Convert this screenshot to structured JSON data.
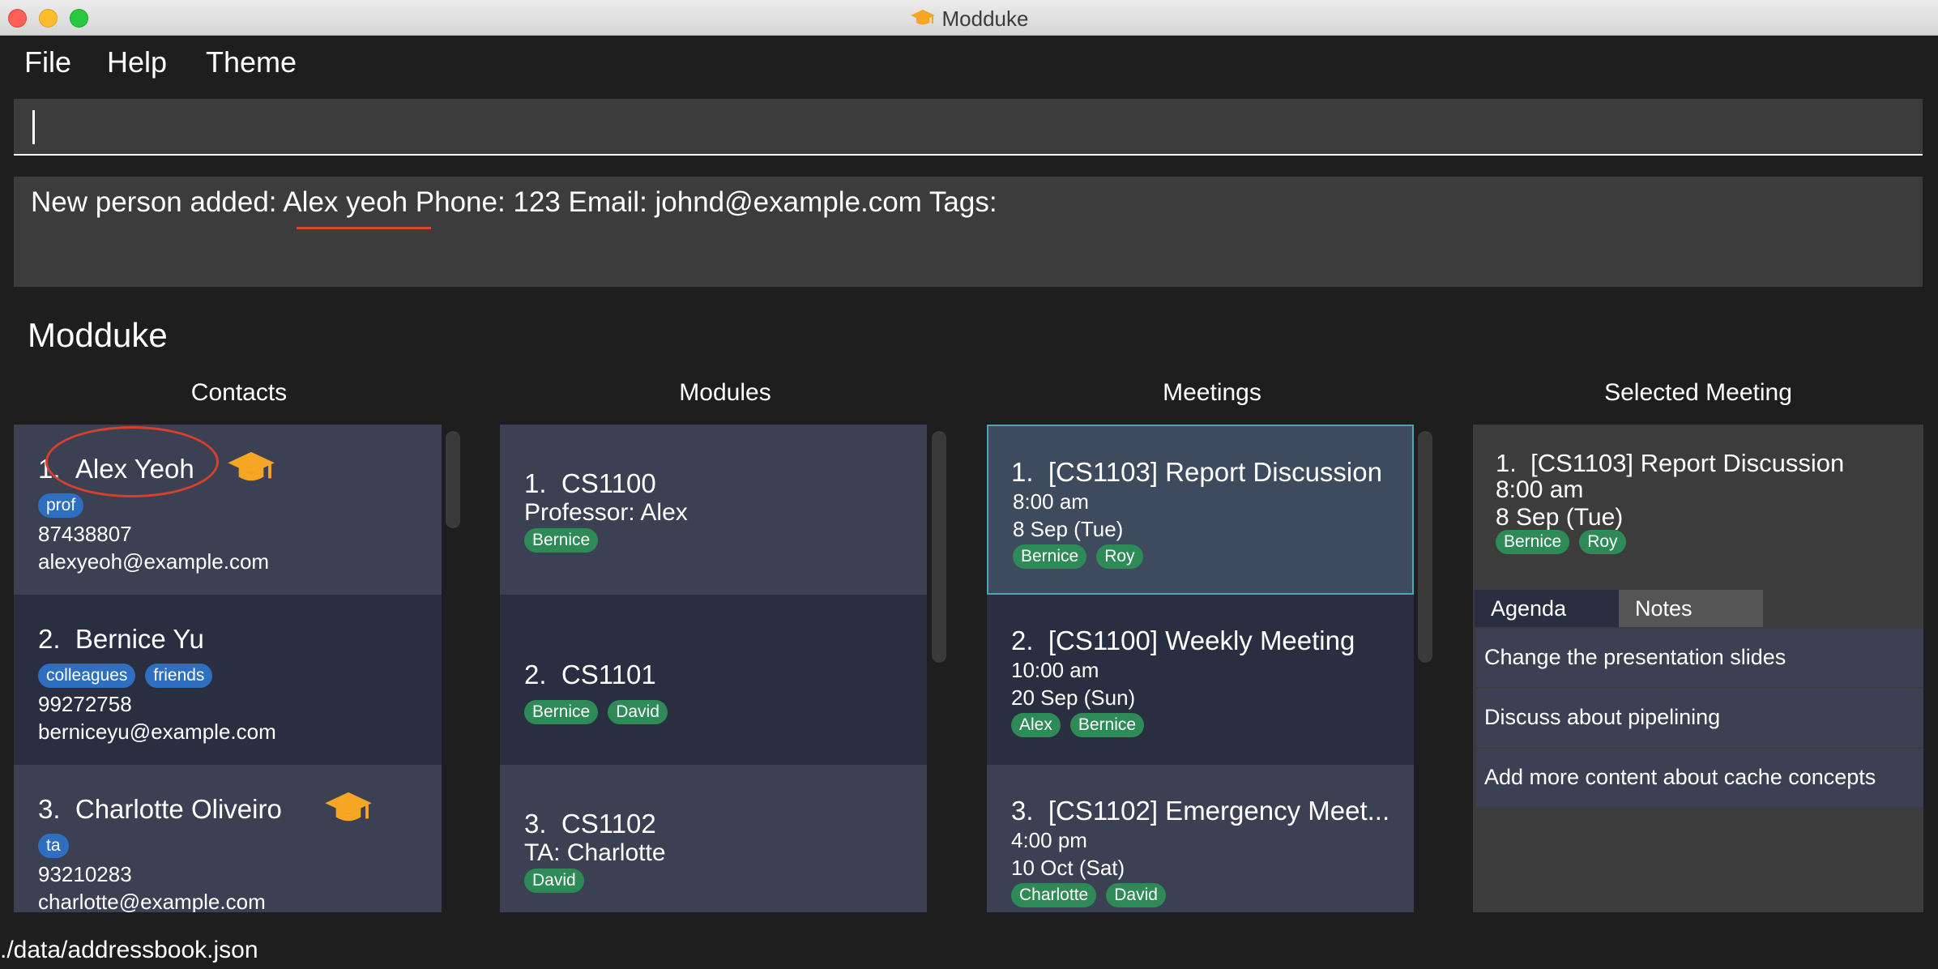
{
  "window": {
    "title": "Modduke"
  },
  "menu": {
    "file": "File",
    "help": "Help",
    "theme": "Theme"
  },
  "command": {
    "value": ""
  },
  "result": {
    "text_before": "New person added: ",
    "name": "Alex yeoh",
    "text_after": " Phone: 123 Email: johnd@example.com Tags:"
  },
  "app_title": "Modduke",
  "headers": {
    "contacts": "Contacts",
    "modules": "Modules",
    "meetings": "Meetings",
    "selected": "Selected Meeting"
  },
  "contacts": [
    {
      "index": "1.",
      "name": "Alex Yeoh",
      "tags": [
        "prof"
      ],
      "phone": "87438807",
      "email": "alexyeoh@example.com",
      "icon": "graduation-cap-icon"
    },
    {
      "index": "2.",
      "name": "Bernice Yu",
      "tags": [
        "colleagues",
        "friends"
      ],
      "phone": "99272758",
      "email": "berniceyu@example.com"
    },
    {
      "index": "3.",
      "name": "Charlotte Oliveiro",
      "tags": [
        "ta"
      ],
      "phone": "93210283",
      "email": "charlotte@example.com",
      "icon": "graduation-cap-icon"
    }
  ],
  "modules": [
    {
      "index": "1.",
      "code": "CS1100",
      "role": "Professor: Alex",
      "tags": [
        "Bernice"
      ]
    },
    {
      "index": "2.",
      "code": "CS1101",
      "role": "",
      "tags": [
        "Bernice",
        "David"
      ]
    },
    {
      "index": "3.",
      "code": "CS1102",
      "role": "TA: Charlotte",
      "tags": [
        "David"
      ]
    }
  ],
  "meetings": [
    {
      "index": "1.",
      "title": "[CS1103] Report Discussion",
      "time": "8:00 am",
      "date": "8 Sep (Tue)",
      "tags": [
        "Bernice",
        "Roy"
      ]
    },
    {
      "index": "2.",
      "title": "[CS1100] Weekly Meeting",
      "time": "10:00 am",
      "date": "20 Sep (Sun)",
      "tags": [
        "Alex",
        "Bernice"
      ]
    },
    {
      "index": "3.",
      "title": "[CS1102] Emergency Meet...",
      "time": "4:00 pm",
      "date": "10 Oct (Sat)",
      "tags": [
        "Charlotte",
        "David"
      ]
    }
  ],
  "selected_meeting": {
    "index": "1.",
    "title": "[CS1103] Report Discussion",
    "time": "8:00 am",
    "date": "8 Sep (Tue)",
    "tags": [
      "Bernice",
      "Roy"
    ],
    "tabs": [
      "Agenda",
      "Notes"
    ],
    "agenda": [
      "Change the presentation slides",
      "Discuss about pipelining",
      "Add more content about cache concepts"
    ]
  },
  "status": {
    "path": "./data/addressbook.json"
  },
  "colors": {
    "accent_tag_blue": "#2e6fc2",
    "accent_tag_green": "#2e8b57",
    "cap_orange": "#f5a623",
    "annotation_red": "#d8402c"
  }
}
